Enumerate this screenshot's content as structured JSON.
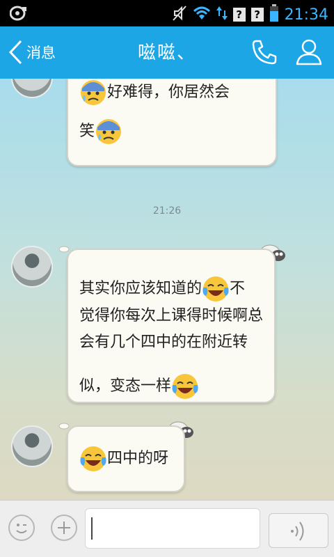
{
  "status_bar": {
    "time": "21:34",
    "question_badge": "?",
    "icons": [
      "notification-icon",
      "mute-icon",
      "wifi-icon",
      "data-arrows-icon",
      "sim-icon",
      "sim-icon",
      "battery-icon"
    ]
  },
  "header": {
    "back_label": "消息",
    "title": "嗞嗞、",
    "accent": "#1ca6e6"
  },
  "chat": {
    "time_label": "21:26",
    "messages": [
      {
        "sender": "contact",
        "lines": [
          "好难得，你居然会",
          "笑"
        ]
      },
      {
        "sender": "contact",
        "lines": [
          "其实你应该知道的",
          "不",
          "觉得你每次上课得时候啊总",
          "会有几个四中的在附近转",
          "",
          "似，变态一样"
        ]
      },
      {
        "sender": "contact",
        "lines": [
          "四中的呀"
        ]
      }
    ]
  },
  "input_bar": {
    "icons": [
      "emoji-face-icon",
      "plus-icon",
      "voice-wave-icon"
    ],
    "value": ""
  }
}
